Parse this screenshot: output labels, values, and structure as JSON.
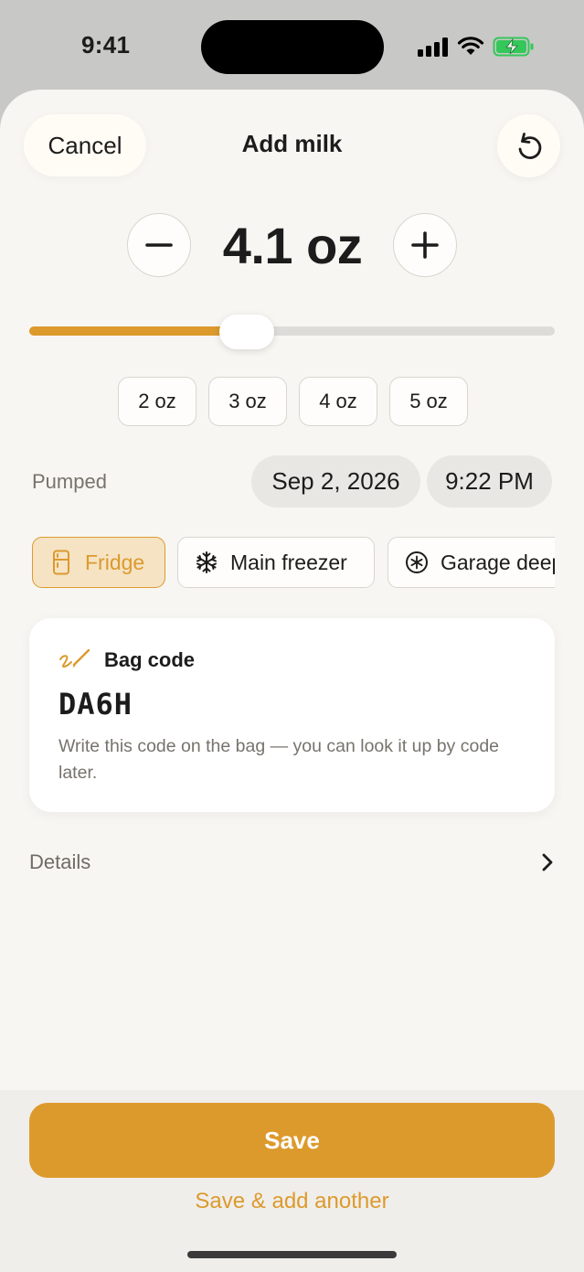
{
  "status_bar": {
    "time": "9:41",
    "icons": [
      "cellular-signal-icon",
      "wifi-icon",
      "battery-charging-icon"
    ],
    "battery_color": "#34c759"
  },
  "header": {
    "cancel_label": "Cancel",
    "title": "Add milk",
    "reset_icon": "rotate-ccw-icon"
  },
  "amount": {
    "value": "4.1 oz",
    "decrement_icon": "minus-icon",
    "increment_icon": "plus-icon",
    "slider_fraction": 0.4
  },
  "presets": [
    "2 oz",
    "3 oz",
    "4 oz",
    "5 oz"
  ],
  "pumped": {
    "label": "Pumped",
    "date": "Sep 2, 2026",
    "time": "9:22 PM"
  },
  "locations": [
    {
      "label": "Fridge",
      "icon": "fridge-icon",
      "selected": true
    },
    {
      "label": "Main freezer",
      "icon": "snowflake-icon",
      "selected": false
    },
    {
      "label": "Garage deep freezer",
      "icon": "snowflake-circle-icon",
      "selected": false
    }
  ],
  "bag_code": {
    "label": "Bag code",
    "icon": "pencil-scribble-icon",
    "code": "DA6H",
    "note": "Write this code on the bag — you can look it up by code later."
  },
  "details": {
    "label": "Details",
    "icon": "chevron-right-icon"
  },
  "actions": {
    "save_label": "Save",
    "save_another_label": "Save & add another"
  },
  "colors": {
    "accent": "#dc9a2d",
    "accent_light": "#f5e3c4",
    "sheet_background": "#f8f6f2",
    "secondary_text": "#77736c"
  }
}
